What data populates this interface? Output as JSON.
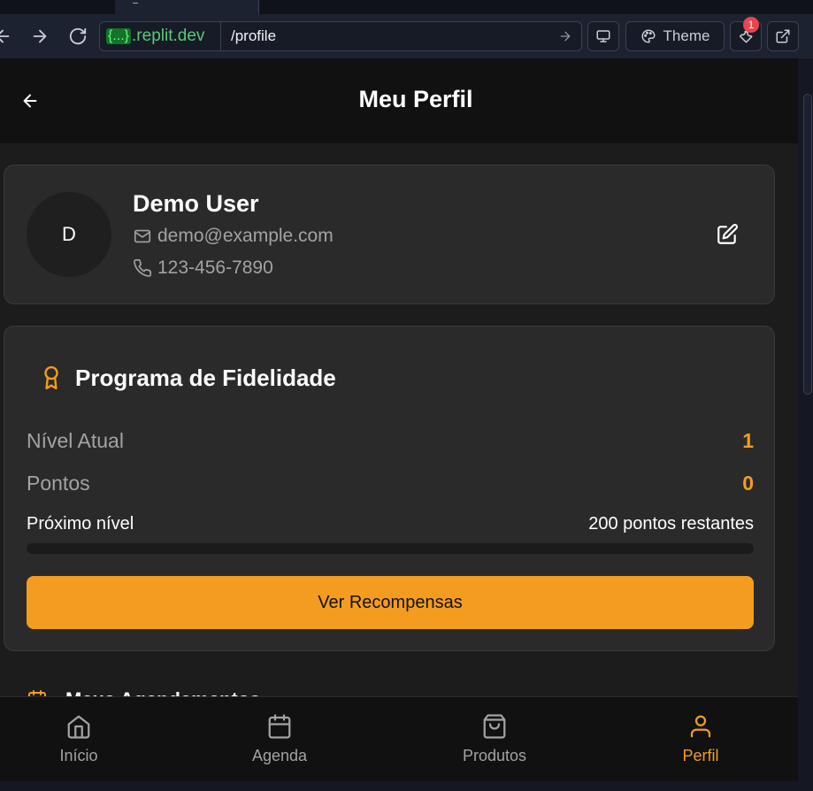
{
  "browser": {
    "url_badge": "{...}",
    "url_domain": ".replit.dev",
    "url_path": "/profile",
    "theme_label": "Theme",
    "devtools_count": "1"
  },
  "header": {
    "title": "Meu Perfil"
  },
  "profile": {
    "avatar_initial": "D",
    "name": "Demo User",
    "email": "demo@example.com",
    "phone": "123-456-7890"
  },
  "loyalty": {
    "title": "Programa de Fidelidade",
    "level_label": "Nível Atual",
    "level_value": "1",
    "points_label": "Pontos",
    "points_value": "0",
    "next_label": "Próximo nível",
    "remaining_text": "200 pontos restantes",
    "progress_fraction": 0,
    "cta_label": "Ver Recompensas"
  },
  "next_section": {
    "title": "Meus Agendamentos"
  },
  "bottom_nav": [
    {
      "label": "Início",
      "icon": "home-icon"
    },
    {
      "label": "Agenda",
      "icon": "calendar-icon"
    },
    {
      "label": "Produtos",
      "icon": "shopping-bag-icon"
    },
    {
      "label": "Perfil",
      "icon": "user-icon",
      "active": true
    }
  ],
  "colors": {
    "accent": "#f39c1f",
    "card": "#2a2a2a",
    "background": "#1c1c1c",
    "header": "#111111",
    "muted_text": "#a3a3a3"
  }
}
